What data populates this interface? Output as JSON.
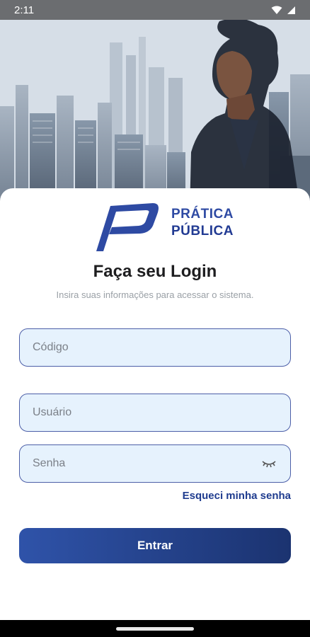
{
  "status_bar": {
    "time": "2:11"
  },
  "brand": {
    "line1": "PRÁTICA",
    "line2": "PÚBLICA"
  },
  "login": {
    "title": "Faça seu Login",
    "subtitle": "Insira suas informações para acessar o sistema.",
    "code_placeholder": "Código",
    "user_placeholder": "Usuário",
    "password_placeholder": "Senha",
    "forgot_password": "Esqueci minha senha",
    "submit": "Entrar"
  },
  "colors": {
    "brand_blue": "#2e4aa3",
    "field_bg": "#e6f2fd",
    "field_border": "#4c5fa8",
    "button_start": "#2f53a9",
    "button_end": "#1b3370"
  },
  "icons": [
    "wifi-icon",
    "signal-icon",
    "eye-off-icon",
    "brand-logo-icon"
  ]
}
